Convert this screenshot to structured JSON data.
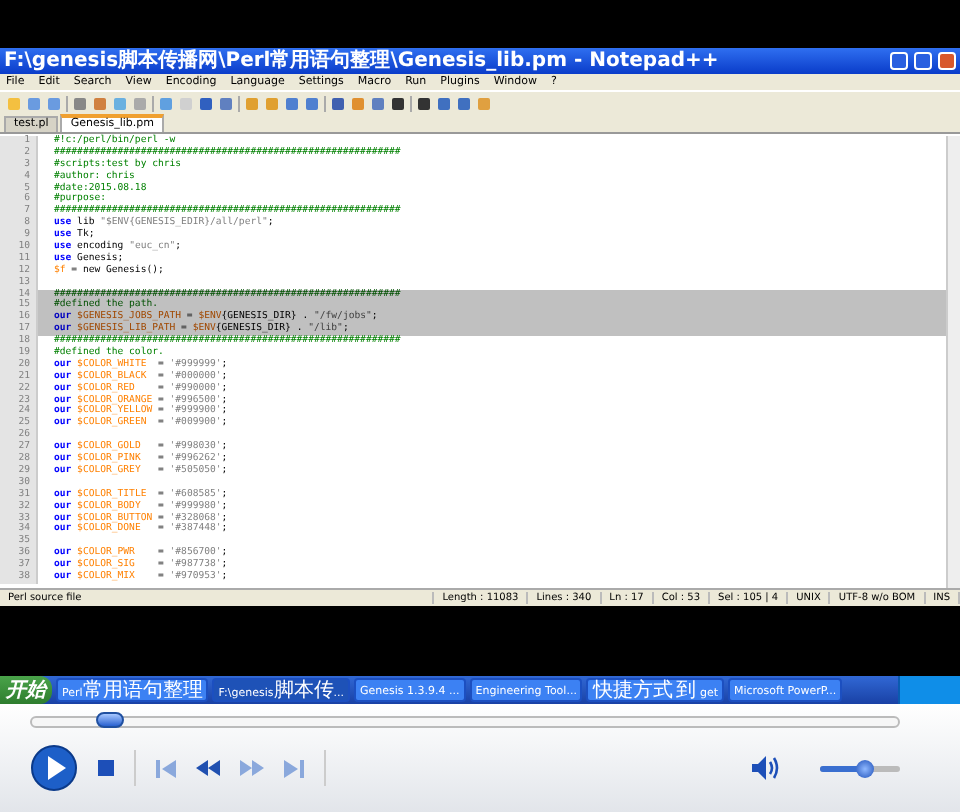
{
  "video_frame": {
    "window": {
      "title": "F:\\genesis脚本传播网\\Perl常用语句整理\\Genesis_lib.pm - Notepad++",
      "menu": [
        "File",
        "Edit",
        "Search",
        "View",
        "Encoding",
        "Language",
        "Settings",
        "Macro",
        "Run",
        "Plugins",
        "Window",
        "?"
      ],
      "tabs": [
        {
          "label": "test.pl",
          "selected": false
        },
        {
          "label": "Genesis_lib.pm",
          "selected": true
        }
      ],
      "lines": [
        {
          "number": "1",
          "selected": false,
          "segments": [
            {
              "kind": "comment",
              "text": "#!c:/perl/bin/perl -w"
            }
          ]
        },
        {
          "number": "2",
          "selected": false,
          "segments": [
            {
              "kind": "comment",
              "text": "############################################################"
            }
          ]
        },
        {
          "number": "3",
          "selected": false,
          "segments": [
            {
              "kind": "comment",
              "text": "#scripts:test by chris"
            }
          ]
        },
        {
          "number": "4",
          "selected": false,
          "segments": [
            {
              "kind": "comment",
              "text": "#author: chris"
            }
          ]
        },
        {
          "number": "5",
          "selected": false,
          "segments": [
            {
              "kind": "comment",
              "text": "#date:2015.08.18"
            }
          ]
        },
        {
          "number": "6",
          "selected": false,
          "segments": [
            {
              "kind": "comment",
              "text": "#purpose:"
            }
          ]
        },
        {
          "number": "7",
          "selected": false,
          "segments": [
            {
              "kind": "comment",
              "text": "############################################################"
            }
          ]
        },
        {
          "number": "8",
          "selected": false,
          "segments": [
            {
              "kind": "keyword",
              "text": "use"
            },
            {
              "kind": "plain",
              "text": " lib "
            },
            {
              "kind": "string",
              "text": "\"$ENV{GENESIS_EDIR}/all/perl\""
            },
            {
              "kind": "plain",
              "text": ";"
            }
          ]
        },
        {
          "number": "9",
          "selected": false,
          "segments": [
            {
              "kind": "keyword",
              "text": "use"
            },
            {
              "kind": "plain",
              "text": " Tk;"
            }
          ]
        },
        {
          "number": "10",
          "selected": false,
          "segments": [
            {
              "kind": "keyword",
              "text": "use"
            },
            {
              "kind": "plain",
              "text": " encoding "
            },
            {
              "kind": "string",
              "text": "\"euc_cn\""
            },
            {
              "kind": "plain",
              "text": ";"
            }
          ]
        },
        {
          "number": "11",
          "selected": false,
          "segments": [
            {
              "kind": "keyword",
              "text": "use"
            },
            {
              "kind": "plain",
              "text": " Genesis;"
            }
          ]
        },
        {
          "number": "12",
          "selected": false,
          "segments": [
            {
              "kind": "variable",
              "text": "$f"
            },
            {
              "kind": "plain",
              "text": " = new Genesis();"
            }
          ]
        },
        {
          "number": "13",
          "selected": false
        },
        {
          "number": "14",
          "selected": true,
          "segments": [
            {
              "kind": "comment",
              "text": "############################################################"
            }
          ]
        },
        {
          "number": "15",
          "selected": true,
          "segments": [
            {
              "kind": "comment",
              "text": "#defined the path."
            }
          ]
        },
        {
          "number": "16",
          "selected": true,
          "segments": [
            {
              "kind": "keyword",
              "text": "our"
            },
            {
              "kind": "variable",
              "text": " $GENESIS_JOBS_PATH"
            },
            {
              "kind": "plain",
              "text": " = "
            },
            {
              "kind": "variable",
              "text": "$ENV"
            },
            {
              "kind": "plain",
              "text": "{GENESIS_DIR} . "
            },
            {
              "kind": "string",
              "text": "\"/fw/jobs\""
            },
            {
              "kind": "plain",
              "text": ";"
            }
          ]
        },
        {
          "number": "17",
          "selected": true,
          "segments": [
            {
              "kind": "keyword",
              "text": "our"
            },
            {
              "kind": "variable",
              "text": " $GENESIS_LIB_PATH"
            },
            {
              "kind": "plain",
              "text": " = "
            },
            {
              "kind": "variable",
              "text": "$ENV"
            },
            {
              "kind": "plain",
              "text": "{GENESIS_DIR} . "
            },
            {
              "kind": "string",
              "text": "\"/lib\""
            },
            {
              "kind": "plain",
              "text": ";"
            }
          ]
        },
        {
          "number": "18",
          "selected": false,
          "segments": [
            {
              "kind": "comment",
              "text": "############################################################"
            }
          ]
        },
        {
          "number": "19",
          "selected": false,
          "segments": [
            {
              "kind": "comment",
              "text": "#defined the color."
            }
          ]
        },
        {
          "number": "20",
          "selected": false,
          "segments": [
            {
              "kind": "keyword",
              "text": "our"
            },
            {
              "kind": "variable",
              "text": " $COLOR_WHITE "
            },
            {
              "kind": "plain",
              "text": " = "
            },
            {
              "kind": "string",
              "text": "'#999999'"
            },
            {
              "kind": "plain",
              "text": ";"
            }
          ]
        },
        {
          "number": "21",
          "selected": false,
          "segments": [
            {
              "kind": "keyword",
              "text": "our"
            },
            {
              "kind": "variable",
              "text": " $COLOR_BLACK "
            },
            {
              "kind": "plain",
              "text": " = "
            },
            {
              "kind": "string",
              "text": "'#000000'"
            },
            {
              "kind": "plain",
              "text": ";"
            }
          ]
        },
        {
          "number": "22",
          "selected": false,
          "segments": [
            {
              "kind": "keyword",
              "text": "our"
            },
            {
              "kind": "variable",
              "text": " $COLOR_RED   "
            },
            {
              "kind": "plain",
              "text": " = "
            },
            {
              "kind": "string",
              "text": "'#990000'"
            },
            {
              "kind": "plain",
              "text": ";"
            }
          ]
        },
        {
          "number": "23",
          "selected": false,
          "segments": [
            {
              "kind": "keyword",
              "text": "our"
            },
            {
              "kind": "variable",
              "text": " $COLOR_ORANGE"
            },
            {
              "kind": "plain",
              "text": " = "
            },
            {
              "kind": "string",
              "text": "'#996500'"
            },
            {
              "kind": "plain",
              "text": ";"
            }
          ]
        },
        {
          "number": "24",
          "selected": false,
          "segments": [
            {
              "kind": "keyword",
              "text": "our"
            },
            {
              "kind": "variable",
              "text": " $COLOR_YELLOW"
            },
            {
              "kind": "plain",
              "text": " = "
            },
            {
              "kind": "string",
              "text": "'#999900'"
            },
            {
              "kind": "plain",
              "text": ";"
            }
          ]
        },
        {
          "number": "25",
          "selected": false,
          "segments": [
            {
              "kind": "keyword",
              "text": "our"
            },
            {
              "kind": "variable",
              "text": " $COLOR_GREEN "
            },
            {
              "kind": "plain",
              "text": " = "
            },
            {
              "kind": "string",
              "text": "'#009900'"
            },
            {
              "kind": "plain",
              "text": ";"
            }
          ]
        },
        {
          "number": "26",
          "selected": false
        },
        {
          "number": "27",
          "selected": false,
          "segments": [
            {
              "kind": "keyword",
              "text": "our"
            },
            {
              "kind": "variable",
              "text": " $COLOR_GOLD  "
            },
            {
              "kind": "plain",
              "text": " = "
            },
            {
              "kind": "string",
              "text": "'#998030'"
            },
            {
              "kind": "plain",
              "text": ";"
            }
          ]
        },
        {
          "number": "28",
          "selected": false,
          "segments": [
            {
              "kind": "keyword",
              "text": "our"
            },
            {
              "kind": "variable",
              "text": " $COLOR_PINK  "
            },
            {
              "kind": "plain",
              "text": " = "
            },
            {
              "kind": "string",
              "text": "'#996262'"
            },
            {
              "kind": "plain",
              "text": ";"
            }
          ]
        },
        {
          "number": "29",
          "selected": false,
          "segments": [
            {
              "kind": "keyword",
              "text": "our"
            },
            {
              "kind": "variable",
              "text": " $COLOR_GREY  "
            },
            {
              "kind": "plain",
              "text": " = "
            },
            {
              "kind": "string",
              "text": "'#505050'"
            },
            {
              "kind": "plain",
              "text": ";"
            }
          ]
        },
        {
          "number": "30",
          "selected": false
        },
        {
          "number": "31",
          "selected": false,
          "segments": [
            {
              "kind": "keyword",
              "text": "our"
            },
            {
              "kind": "variable",
              "text": " $COLOR_TITLE "
            },
            {
              "kind": "plain",
              "text": " = "
            },
            {
              "kind": "string",
              "text": "'#608585'"
            },
            {
              "kind": "plain",
              "text": ";"
            }
          ]
        },
        {
          "number": "32",
          "selected": false,
          "segments": [
            {
              "kind": "keyword",
              "text": "our"
            },
            {
              "kind": "variable",
              "text": " $COLOR_BODY  "
            },
            {
              "kind": "plain",
              "text": " = "
            },
            {
              "kind": "string",
              "text": "'#999980'"
            },
            {
              "kind": "plain",
              "text": ";"
            }
          ]
        },
        {
          "number": "33",
          "selected": false,
          "segments": [
            {
              "kind": "keyword",
              "text": "our"
            },
            {
              "kind": "variable",
              "text": " $COLOR_BUTTON"
            },
            {
              "kind": "plain",
              "text": " = "
            },
            {
              "kind": "string",
              "text": "'#328068'"
            },
            {
              "kind": "plain",
              "text": ";"
            }
          ]
        },
        {
          "number": "34",
          "selected": false,
          "segments": [
            {
              "kind": "keyword",
              "text": "our"
            },
            {
              "kind": "variable",
              "text": " $COLOR_DONE  "
            },
            {
              "kind": "plain",
              "text": " = "
            },
            {
              "kind": "string",
              "text": "'#387448'"
            },
            {
              "kind": "plain",
              "text": ";"
            }
          ]
        },
        {
          "number": "35",
          "selected": false
        },
        {
          "number": "36",
          "selected": false,
          "segments": [
            {
              "kind": "keyword",
              "text": "our"
            },
            {
              "kind": "variable",
              "text": " $COLOR_PWR   "
            },
            {
              "kind": "plain",
              "text": " = "
            },
            {
              "kind": "string",
              "text": "'#856700'"
            },
            {
              "kind": "plain",
              "text": ";"
            }
          ]
        },
        {
          "number": "37",
          "selected": false,
          "segments": [
            {
              "kind": "keyword",
              "text": "our"
            },
            {
              "kind": "variable",
              "text": " $COLOR_SIG   "
            },
            {
              "kind": "plain",
              "text": " = "
            },
            {
              "kind": "string",
              "text": "'#987738'"
            },
            {
              "kind": "plain",
              "text": ";"
            }
          ]
        },
        {
          "number": "38",
          "selected": false,
          "segments": [
            {
              "kind": "keyword",
              "text": "our"
            },
            {
              "kind": "variable",
              "text": " $COLOR_MIX   "
            },
            {
              "kind": "plain",
              "text": " = "
            },
            {
              "kind": "string",
              "text": "'#970953'"
            },
            {
              "kind": "plain",
              "text": ";"
            }
          ]
        }
      ],
      "status_bar": [
        "Perl source file",
        "Length : 11083",
        "Lines : 340",
        "Ln : 17",
        "Col : 53",
        "Sel : 105 | 4",
        "UNIX",
        "UTF-8 w/o BOM",
        "INS"
      ]
    },
    "taskbar": {
      "start": "开始",
      "items": [
        {
          "label": "Perl常用语句整理",
          "selected": false
        },
        {
          "label": "F:\\genesis脚本传...",
          "selected": true
        },
        {
          "label": "Genesis 1.3.9.4 ...",
          "selected": false
        },
        {
          "label": "Engineering Tool...",
          "selected": false
        },
        {
          "label": "快捷方式 到 get",
          "selected": false
        },
        {
          "label": "Microsoft PowerP...",
          "selected": false
        }
      ]
    }
  },
  "player": {
    "seek": {
      "level": 0.09
    },
    "volume": {
      "level": 0.55
    }
  }
}
